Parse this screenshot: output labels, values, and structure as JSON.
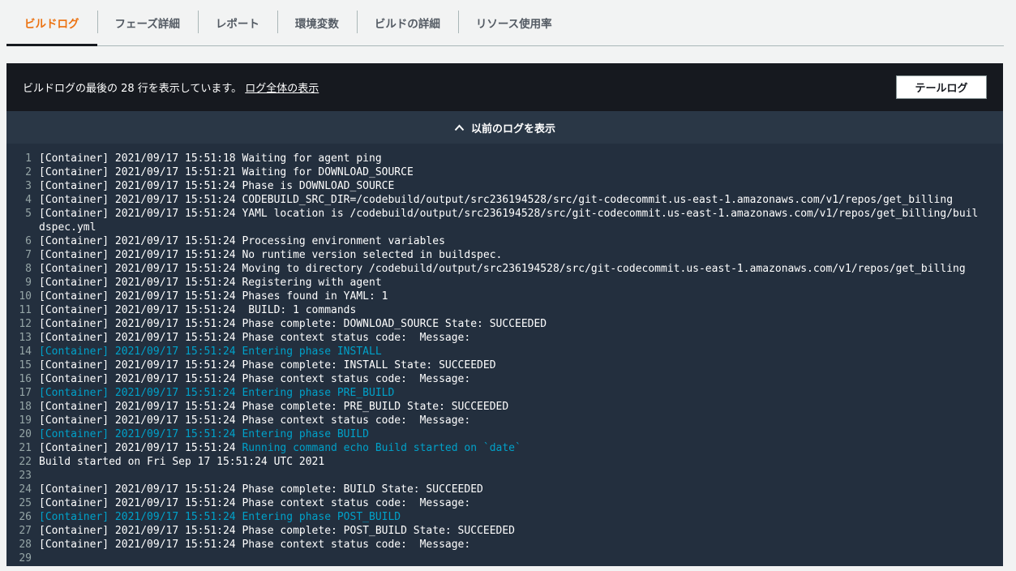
{
  "tabs": [
    {
      "label": "ビルドログ",
      "active": true
    },
    {
      "label": "フェーズ詳細",
      "active": false
    },
    {
      "label": "レポート",
      "active": false
    },
    {
      "label": "環境変数",
      "active": false
    },
    {
      "label": "ビルドの詳細",
      "active": false
    },
    {
      "label": "リソース使用率",
      "active": false
    }
  ],
  "panel": {
    "summary_text": "ビルドログの最後の 28 行を表示しています。",
    "full_log_link": "ログ全体の表示",
    "tail_button": "テールログ",
    "show_previous": "以前のログを表示",
    "show_previous_icon": "chevron-up-icon"
  },
  "colors": {
    "accent": "#ec7211",
    "log_background": "#232f3e",
    "header_background": "#16191f",
    "highlight_text": "#00a1c9"
  },
  "log_lines": [
    {
      "n": "1",
      "text": "[Container] 2021/09/17 15:51:18 Waiting for agent ping"
    },
    {
      "n": "2",
      "text": "[Container] 2021/09/17 15:51:21 Waiting for DOWNLOAD_SOURCE"
    },
    {
      "n": "3",
      "text": "[Container] 2021/09/17 15:51:24 Phase is DOWNLOAD_SOURCE"
    },
    {
      "n": "4",
      "text": "[Container] 2021/09/17 15:51:24 CODEBUILD_SRC_DIR=/codebuild/output/src236194528/src/git-codecommit.us-east-1.amazonaws.com/v1/repos/get_billing"
    },
    {
      "n": "5",
      "text": "[Container] 2021/09/17 15:51:24 YAML location is /codebuild/output/src236194528/src/git-codecommit.us-east-1.amazonaws.com/v1/repos/get_billing/buildspec.yml"
    },
    {
      "n": "6",
      "text": "[Container] 2021/09/17 15:51:24 Processing environment variables"
    },
    {
      "n": "7",
      "text": "[Container] 2021/09/17 15:51:24 No runtime version selected in buildspec."
    },
    {
      "n": "8",
      "text": "[Container] 2021/09/17 15:51:24 Moving to directory /codebuild/output/src236194528/src/git-codecommit.us-east-1.amazonaws.com/v1/repos/get_billing"
    },
    {
      "n": "9",
      "text": "[Container] 2021/09/17 15:51:24 Registering with agent"
    },
    {
      "n": "10",
      "text": "[Container] 2021/09/17 15:51:24 Phases found in YAML: 1"
    },
    {
      "n": "11",
      "text": "[Container] 2021/09/17 15:51:24  BUILD: 1 commands"
    },
    {
      "n": "12",
      "text": "[Container] 2021/09/17 15:51:24 Phase complete: DOWNLOAD_SOURCE State: SUCCEEDED"
    },
    {
      "n": "13",
      "text": "[Container] 2021/09/17 15:51:24 Phase context status code:  Message:"
    },
    {
      "n": "14",
      "text": "[Container] 2021/09/17 15:51:24 Entering phase INSTALL",
      "highlight": true
    },
    {
      "n": "15",
      "text": "[Container] 2021/09/17 15:51:24 Phase complete: INSTALL State: SUCCEEDED"
    },
    {
      "n": "16",
      "text": "[Container] 2021/09/17 15:51:24 Phase context status code:  Message:"
    },
    {
      "n": "17",
      "text": "[Container] 2021/09/17 15:51:24 Entering phase PRE_BUILD",
      "highlight": true
    },
    {
      "n": "18",
      "text": "[Container] 2021/09/17 15:51:24 Phase complete: PRE_BUILD State: SUCCEEDED"
    },
    {
      "n": "19",
      "text": "[Container] 2021/09/17 15:51:24 Phase context status code:  Message:"
    },
    {
      "n": "20",
      "text": "[Container] 2021/09/17 15:51:24 Entering phase BUILD",
      "highlight": true
    },
    {
      "n": "21",
      "text": "[Container] 2021/09/17 15:51:24 ",
      "highlight_suffix": "Running command echo Build started on `date`"
    },
    {
      "n": "22",
      "text": "Build started on Fri Sep 17 15:51:24 UTC 2021"
    },
    {
      "n": "23",
      "text": ""
    },
    {
      "n": "24",
      "text": "[Container] 2021/09/17 15:51:24 Phase complete: BUILD State: SUCCEEDED"
    },
    {
      "n": "25",
      "text": "[Container] 2021/09/17 15:51:24 Phase context status code:  Message:"
    },
    {
      "n": "26",
      "text": "[Container] 2021/09/17 15:51:24 Entering phase POST_BUILD",
      "highlight": true
    },
    {
      "n": "27",
      "text": "[Container] 2021/09/17 15:51:24 Phase complete: POST_BUILD State: SUCCEEDED"
    },
    {
      "n": "28",
      "text": "[Container] 2021/09/17 15:51:24 Phase context status code:  Message:"
    },
    {
      "n": "29",
      "text": ""
    }
  ]
}
